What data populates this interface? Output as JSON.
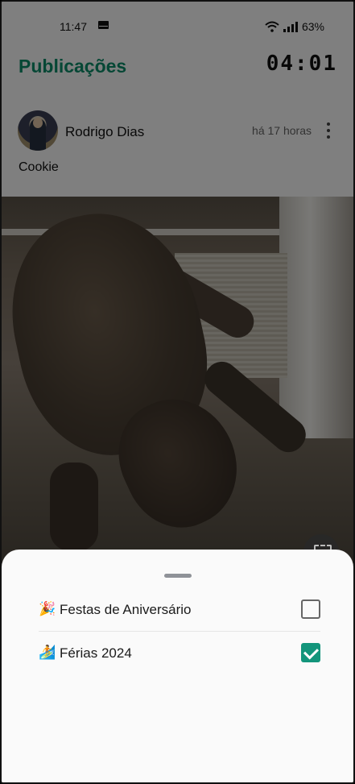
{
  "status_bar": {
    "time": "11:47",
    "battery": "63%",
    "icons": [
      "mail-icon",
      "wifi-icon",
      "signal-icon"
    ]
  },
  "app_bar": {
    "title": "Publicações",
    "timer": "04:01",
    "title_color": "#0d8f6a"
  },
  "post": {
    "author": "Rodrigo Dias",
    "time_ago": "há 17 horas",
    "caption": "Cookie"
  },
  "sheet": {
    "options": [
      {
        "emoji": "🎉",
        "label": "Festas de Aniversário",
        "checked": false
      },
      {
        "emoji": "🏄",
        "label": "Férias 2024",
        "checked": true
      }
    ],
    "accent": "#13957b"
  }
}
